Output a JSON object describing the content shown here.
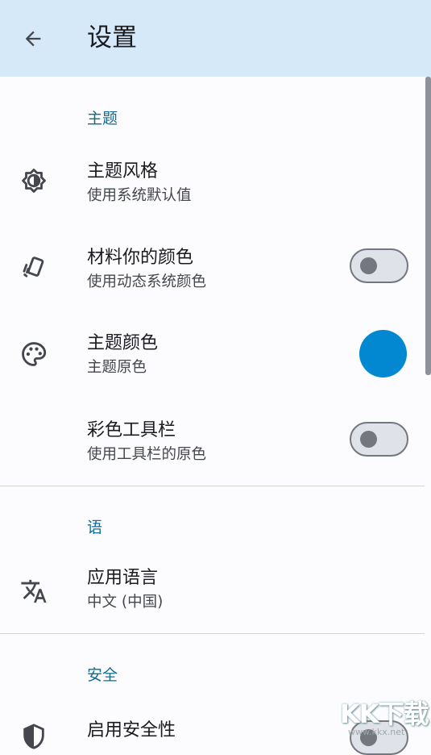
{
  "header": {
    "title": "设置",
    "back_icon": "arrow-back-icon"
  },
  "sections": [
    {
      "title": "主题"
    },
    {
      "title": "语"
    },
    {
      "title": "安全"
    }
  ],
  "items": [
    {
      "title": "主题风格",
      "subtitle": "使用系统默认值",
      "icon": "brightness-auto-icon"
    },
    {
      "title": "材料你的颜色",
      "subtitle": "使用动态系统颜色",
      "icon": "cards-icon",
      "toggle": "off"
    },
    {
      "title": "主题颜色",
      "subtitle": "主题原色",
      "icon": "palette-icon",
      "color": "#0288d1"
    },
    {
      "title": "彩色工具栏",
      "subtitle": "使用工具栏的原色",
      "toggle": "off"
    },
    {
      "title": "应用语言",
      "subtitle": "中文 (中国)",
      "icon": "translate-icon"
    },
    {
      "title": "启用安全性",
      "icon": "shield-icon",
      "toggle": "off"
    }
  ],
  "watermark": {
    "text": "KK下载",
    "sub": "www.kkx.net"
  },
  "colors": {
    "appbar": "#d6e9f9",
    "accent": "#0e6b93",
    "theme_color": "#0288d1"
  }
}
